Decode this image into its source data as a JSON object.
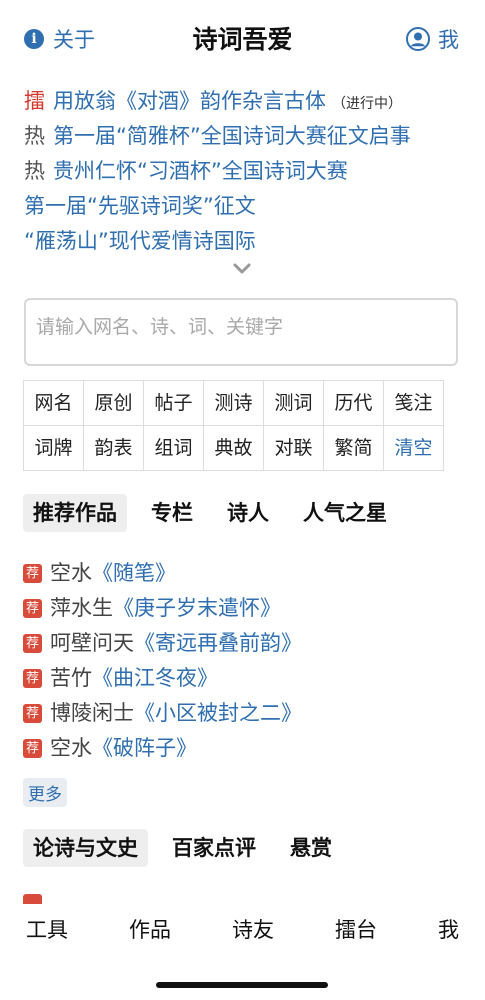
{
  "header": {
    "about_label": "关于",
    "title": "诗词吾爱",
    "me_label": "我"
  },
  "news": [
    {
      "tag": "擂",
      "tag_color": "#d43a2c",
      "text": "用放翁《对酒》韵作杂言古体",
      "note": "（进行中）"
    },
    {
      "tag": "热",
      "tag_color": "#555555",
      "text": "第一届“简雅杯”全国诗词大赛征文启事",
      "note": ""
    },
    {
      "tag": "热",
      "tag_color": "#555555",
      "text": "贵州仁怀“习酒杯”全国诗词大赛",
      "note": ""
    },
    {
      "tag": "",
      "tag_color": "",
      "text": "第一届“先驱诗词奖”征文",
      "note": ""
    },
    {
      "tag": "",
      "tag_color": "",
      "text": "“雁荡山”现代爱情诗国际",
      "note": ""
    }
  ],
  "search": {
    "placeholder": "请输入网名、诗、词、关键字"
  },
  "grid": [
    [
      "网名",
      "原创",
      "帖子",
      "测诗",
      "测词",
      "历代",
      "笺注"
    ],
    [
      "词牌",
      "韵表",
      "组词",
      "典故",
      "对联",
      "繁简",
      "清空"
    ]
  ],
  "tabs1": [
    {
      "label": "推荐作品",
      "active": true
    },
    {
      "label": "专栏",
      "active": false
    },
    {
      "label": "诗人",
      "active": false
    },
    {
      "label": "人气之星",
      "active": false
    }
  ],
  "recommend": {
    "badge": "荐",
    "items": [
      {
        "author": "空水",
        "work": "《随笔》"
      },
      {
        "author": "萍水生",
        "work": "《庚子岁末遣怀》"
      },
      {
        "author": "呵壁问天",
        "work": "《寄远再叠前韵》"
      },
      {
        "author": "苦竹",
        "work": "《曲江冬夜》"
      },
      {
        "author": "博陵闲士",
        "work": "《小区被封之二》"
      },
      {
        "author": "空水",
        "work": "《破阵子》"
      }
    ],
    "more_label": "更多"
  },
  "tabs2": [
    {
      "label": "论诗与文史",
      "active": true
    },
    {
      "label": "百家点评",
      "active": false
    },
    {
      "label": "悬赏",
      "active": false
    }
  ],
  "bottom_nav": [
    "工具",
    "作品",
    "诗友",
    "擂台",
    "我"
  ],
  "colors": {
    "link": "#2f6fb0",
    "badge": "#d84a3a",
    "hot_red": "#d43a2c"
  }
}
